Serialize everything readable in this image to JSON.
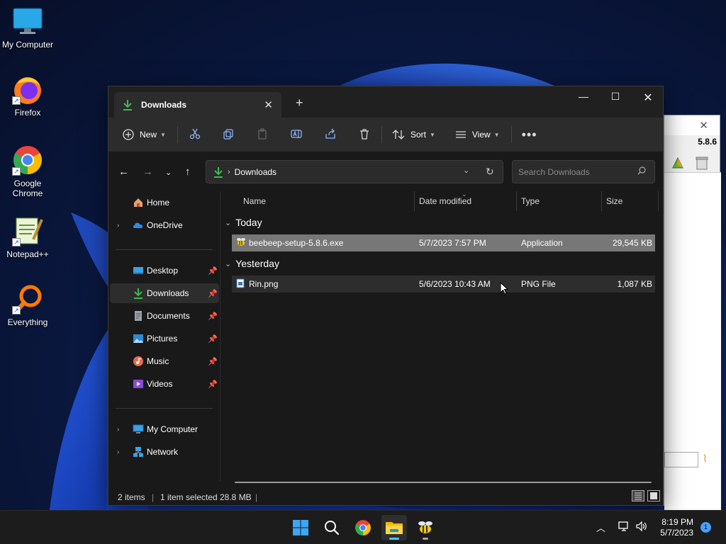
{
  "desktop": {
    "icons": [
      {
        "label": "My Computer"
      },
      {
        "label": "Firefox"
      },
      {
        "label": "Google Chrome"
      },
      {
        "label": "Notepad++"
      },
      {
        "label": "Everything"
      }
    ]
  },
  "background_window": {
    "version": "5.8.6"
  },
  "explorer": {
    "tab": {
      "title": "Downloads"
    },
    "toolbar": {
      "new_label": "New",
      "sort_label": "Sort",
      "view_label": "View"
    },
    "address": {
      "path": "Downloads"
    },
    "search": {
      "placeholder": "Search Downloads"
    },
    "nav": {
      "home": "Home",
      "onedrive": "OneDrive",
      "desktop": "Desktop",
      "downloads": "Downloads",
      "documents": "Documents",
      "pictures": "Pictures",
      "music": "Music",
      "videos": "Videos",
      "my_computer": "My Computer",
      "network": "Network"
    },
    "columns": {
      "name": "Name",
      "date": "Date modified",
      "type": "Type",
      "size": "Size"
    },
    "groups": [
      {
        "label": "Today",
        "files": [
          {
            "name": "beebeep-setup-5.8.6.exe",
            "date": "5/7/2023 7:57 PM",
            "type": "Application",
            "size": "29,545 KB"
          }
        ]
      },
      {
        "label": "Yesterday",
        "files": [
          {
            "name": "Rin.png",
            "date": "5/6/2023 10:43 AM",
            "type": "PNG File",
            "size": "1,087 KB"
          }
        ]
      }
    ],
    "status": {
      "items": "2 items",
      "selected": "1 item selected",
      "size": "28.8 MB"
    }
  },
  "taskbar": {
    "time": "8:19 PM",
    "date": "5/7/2023",
    "notifications": "1"
  },
  "colors": {
    "accent": "#4cc2ff",
    "download_green": "#3fb950"
  }
}
